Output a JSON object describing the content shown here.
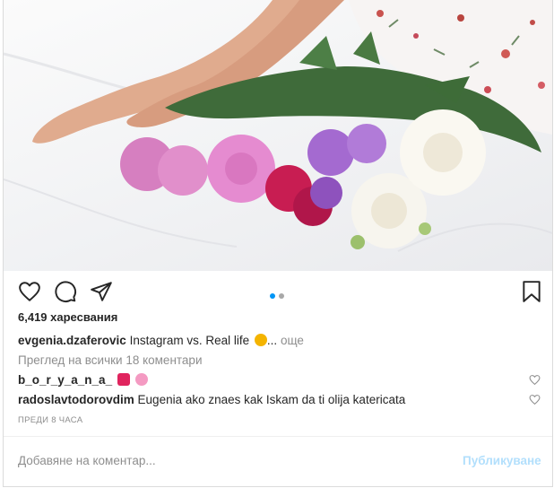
{
  "post": {
    "likes_text": "6,419 харесвания",
    "carousel": {
      "total": 2,
      "active": 1
    },
    "caption": {
      "username": "evgenia.dzaferovic",
      "text": "Instagram vs. Real life",
      "emoji_icon": "grinning-face-emoji",
      "ellipsis": "...",
      "more": "още"
    },
    "view_all_comments": "Преглед на всички 18 коментари",
    "comments": [
      {
        "username": "b_o_r_y_a_n_a_",
        "text": "",
        "emojis": [
          "red-heart-emoji",
          "pink-flower-emoji"
        ]
      },
      {
        "username": "radoslavtodorovdim",
        "text": "Eugenia ako znaes kak Iskam da ti olija katericata"
      }
    ],
    "timestamp": "ПРЕДИ 8 ЧАСА"
  },
  "comment_box": {
    "placeholder": "Добавяне на коментар...",
    "publish_label": "Публикуване"
  },
  "colors": {
    "publish_disabled": "#b2dffc",
    "active_dot": "#0095f6",
    "inactive_dot": "#a8a8a8"
  }
}
